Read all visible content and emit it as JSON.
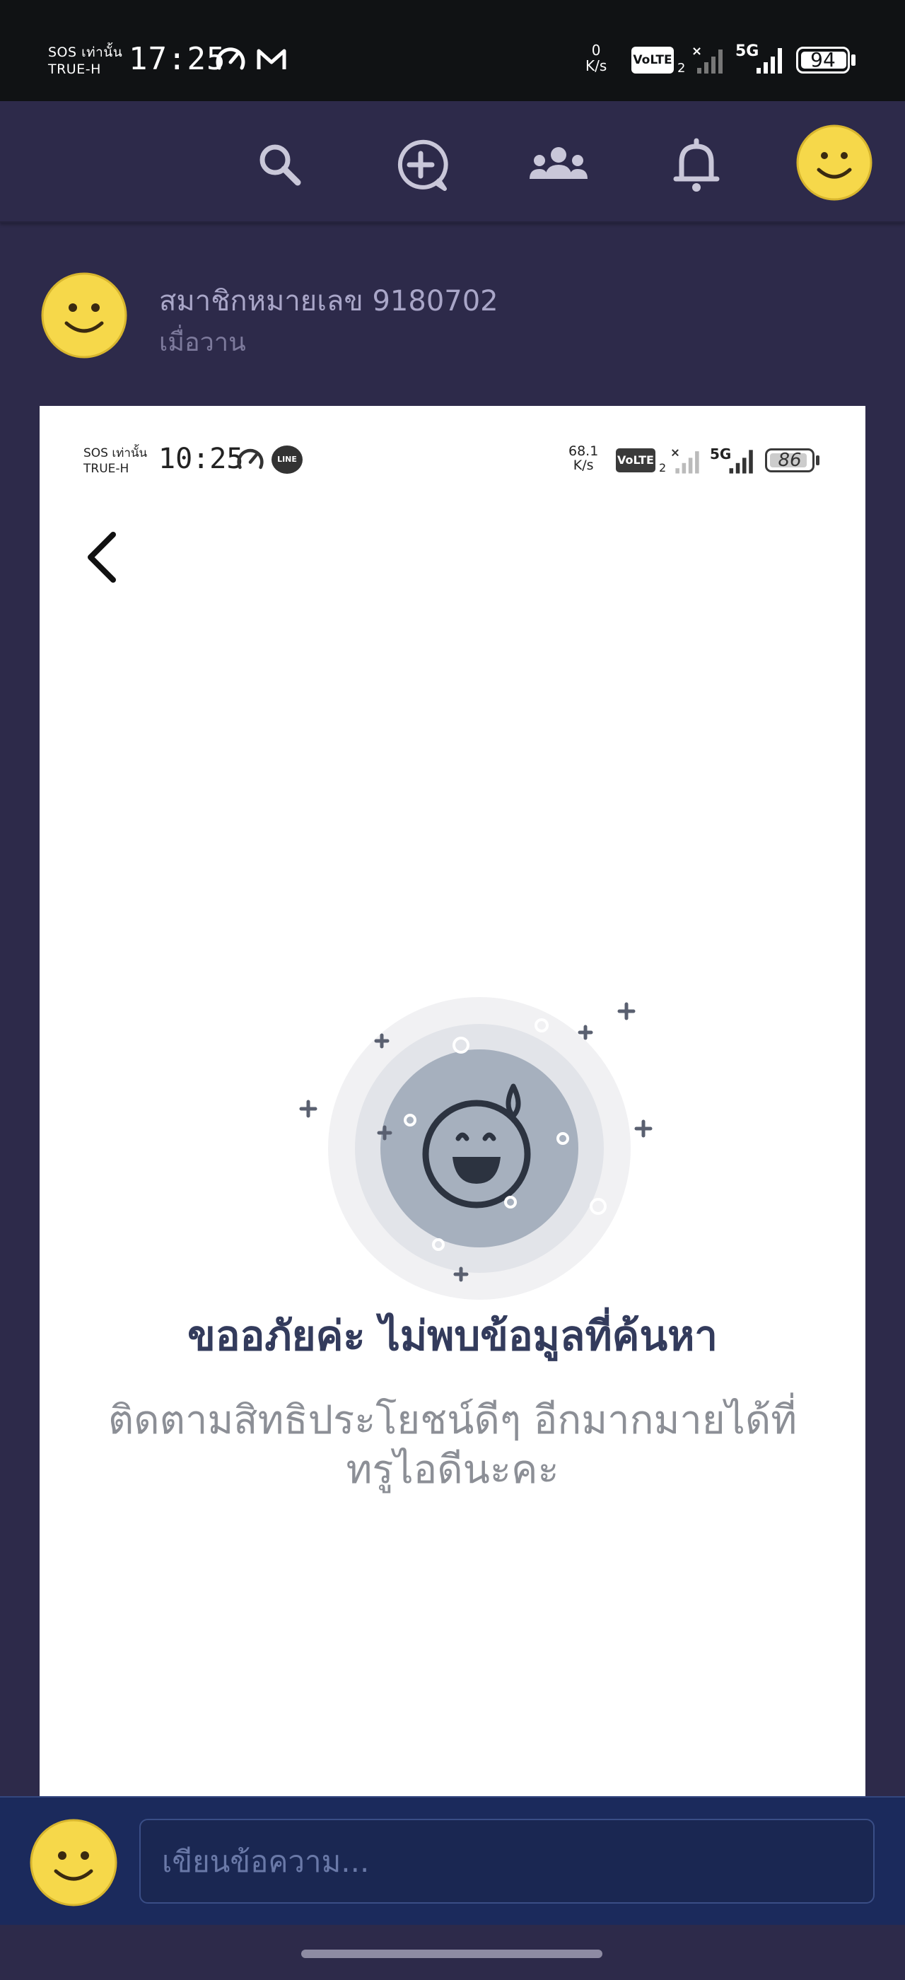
{
  "device_status": {
    "carrier_line1": "SOS เท่านั้น",
    "carrier_line2": "TRUE-H",
    "time": "17:25",
    "net_speed_value": "0",
    "net_speed_unit": "K/s",
    "volte": "VoLTE",
    "volte_sim": "2",
    "network": "5G",
    "battery": "94"
  },
  "header": {
    "icons": [
      "search-icon",
      "add-chat-icon",
      "group-icon",
      "bell-icon",
      "avatar-smiley"
    ]
  },
  "post": {
    "author": "สมาชิกหมายเลข 9180702",
    "time": "เมื่อวาน"
  },
  "embedded_screenshot": {
    "status": {
      "carrier_line1": "SOS เท่านั้น",
      "carrier_line2": "TRUE-H",
      "time": "10:25",
      "app_badge": "LINE",
      "net_speed_value": "68.1",
      "net_speed_unit": "K/s",
      "volte": "VoLTE",
      "volte_sim": "2",
      "network": "5G",
      "battery": "86"
    },
    "empty_state": {
      "title": "ขออภัยค่ะ ไม่พบข้อมูลที่ค้นหา",
      "subtitle": "ติดตามสิทธิประโยชน์ดีๆ อีกมากมายได้ที่ ทรูไอดีนะคะ"
    }
  },
  "composer": {
    "placeholder": "เขียนข้อความ..."
  },
  "colors": {
    "background": "#2d2a4a",
    "composer_bg": "#1b2a5c",
    "smiley": "#f6d84a",
    "empty_title": "#333b5c"
  }
}
